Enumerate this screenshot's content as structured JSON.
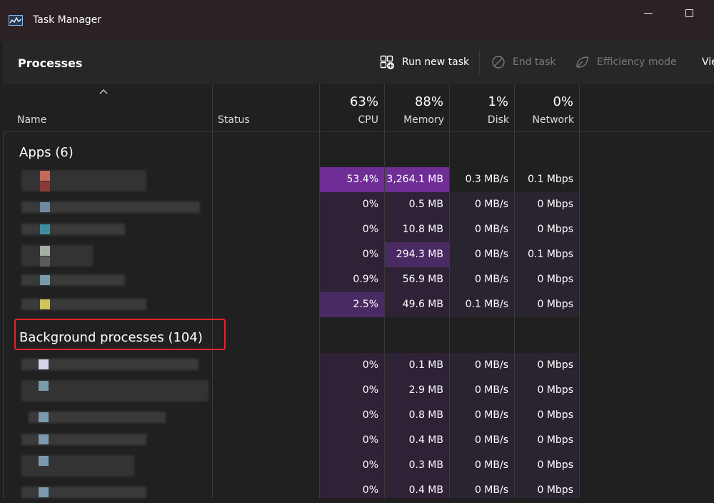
{
  "window": {
    "title": "Task Manager"
  },
  "toolbar": {
    "page_title": "Processes",
    "run_new_task": "Run new task",
    "end_task": "End task",
    "efficiency_mode": "Efficiency mode",
    "view_partial": "Vie"
  },
  "columns": {
    "name": "Name",
    "status": "Status",
    "cpu": {
      "pct": "63%",
      "label": "CPU"
    },
    "memory": {
      "pct": "88%",
      "label": "Memory"
    },
    "disk": {
      "pct": "1%",
      "label": "Disk"
    },
    "network": {
      "pct": "0%",
      "label": "Network"
    }
  },
  "groups": {
    "apps": "Apps (6)",
    "background": "Background processes (104)"
  },
  "apps_rows": [
    {
      "cpu": "53.4%",
      "memory": "3,264.1 MB",
      "disk": "0.3 MB/s",
      "network": "0.1 Mbps"
    },
    {
      "cpu": "0%",
      "memory": "0.5 MB",
      "disk": "0 MB/s",
      "network": "0 Mbps"
    },
    {
      "cpu": "0%",
      "memory": "10.8 MB",
      "disk": "0 MB/s",
      "network": "0 Mbps"
    },
    {
      "cpu": "0%",
      "memory": "294.3 MB",
      "disk": "0 MB/s",
      "network": "0.1 Mbps"
    },
    {
      "cpu": "0.9%",
      "memory": "56.9 MB",
      "disk": "0 MB/s",
      "network": "0 Mbps"
    },
    {
      "cpu": "2.5%",
      "memory": "49.6 MB",
      "disk": "0.1 MB/s",
      "network": "0 Mbps"
    }
  ],
  "background_rows": [
    {
      "cpu": "0%",
      "memory": "0.1 MB",
      "disk": "0 MB/s",
      "network": "0 Mbps"
    },
    {
      "cpu": "0%",
      "memory": "2.9 MB",
      "disk": "0 MB/s",
      "network": "0 Mbps"
    },
    {
      "cpu": "0%",
      "memory": "0.8 MB",
      "disk": "0 MB/s",
      "network": "0 Mbps"
    },
    {
      "cpu": "0%",
      "memory": "0.4 MB",
      "disk": "0 MB/s",
      "network": "0 Mbps"
    },
    {
      "cpu": "0%",
      "memory": "0.3 MB",
      "disk": "0 MB/s",
      "network": "0 Mbps"
    },
    {
      "cpu": "0%",
      "memory": "0.4 MB",
      "disk": "0 MB/s",
      "network": "0 Mbps"
    }
  ],
  "colors": {
    "heat_high": "#6e2e96",
    "heat_mid": "#4a2a62",
    "heat_low": "#2e2236",
    "highlight_box": "#e0242a"
  },
  "icons": [
    "task-manager-icon",
    "run-new-task-icon",
    "end-task-icon",
    "efficiency-mode-icon",
    "sort-up-icon"
  ]
}
